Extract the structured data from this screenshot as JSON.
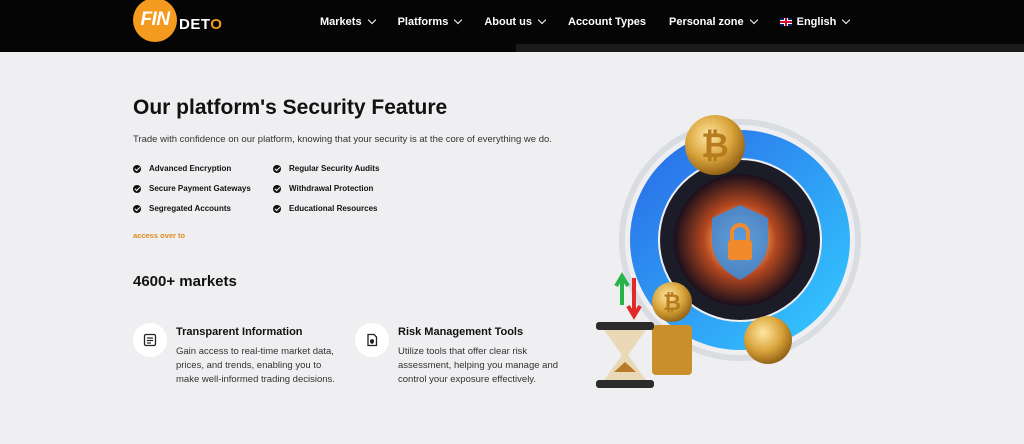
{
  "brand": {
    "logo_fin": "FIN",
    "logo_d": "DET",
    "logo_o": "O"
  },
  "nav": {
    "items": [
      {
        "label": "Markets",
        "has_dropdown": true
      },
      {
        "label": "Platforms",
        "has_dropdown": true
      },
      {
        "label": "About us",
        "has_dropdown": true
      },
      {
        "label": "Account Types",
        "has_dropdown": false
      },
      {
        "label": "Personal zone",
        "has_dropdown": true
      }
    ],
    "language": {
      "label": "English",
      "flag": "uk-flag-icon"
    }
  },
  "hero": {
    "title": "Our platform's Security Feature",
    "intro": "Trade with confidence on our platform, knowing that your security is at the core of everything we do.",
    "features_left": [
      "Advanced Encryption",
      "Secure Payment Gateways",
      "Segregated Accounts"
    ],
    "features_right": [
      "Regular Security Audits",
      "Withdrawal Protection",
      "Educational Resources"
    ],
    "access_link": "access over to",
    "markets_count": "4600+ markets"
  },
  "cards": [
    {
      "icon": "document-chart-icon",
      "title": "Transparent Information",
      "desc": "Gain access to real-time market data, prices, and trends, enabling you to make well-informed trading decisions."
    },
    {
      "icon": "document-shield-icon",
      "title": "Risk Management Tools",
      "desc": "Utilize tools that offer clear risk assessment, helping you manage and control your exposure effectively."
    }
  ],
  "colors": {
    "accent": "#f39a1f",
    "nav_bg": "#050505",
    "page_bg": "#efeff1",
    "link": "#e08a1e"
  }
}
